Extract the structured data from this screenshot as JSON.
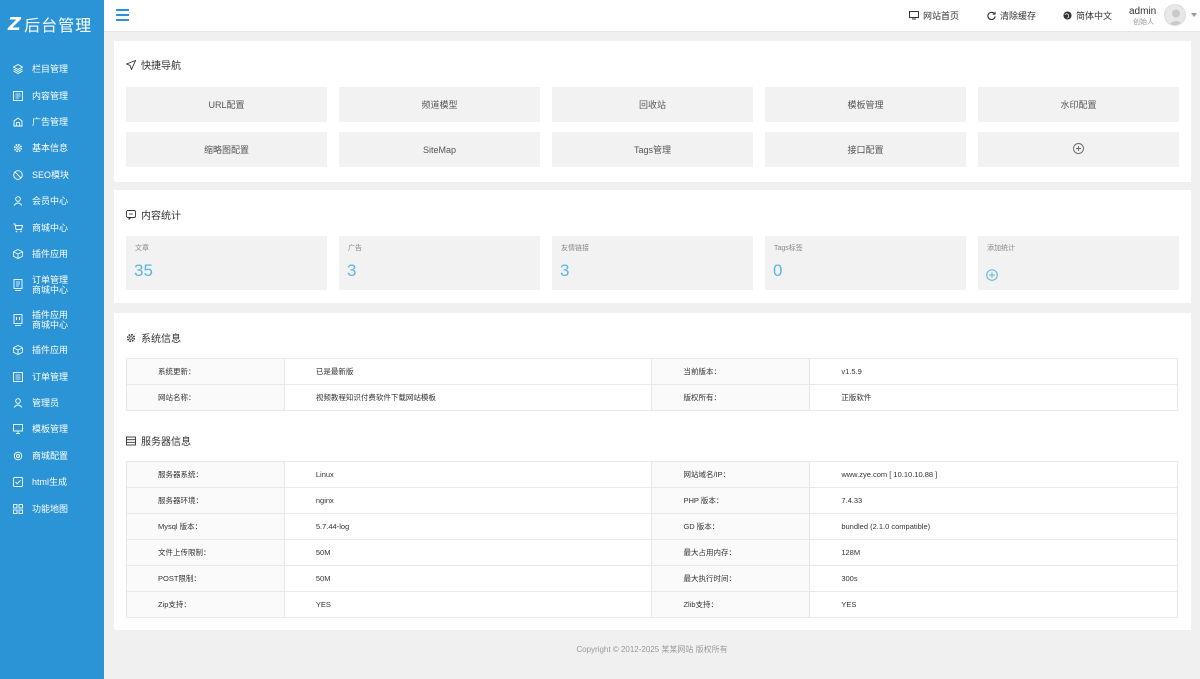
{
  "brand": {
    "logo_mark": "Z",
    "title": "后台管理"
  },
  "sidebar": {
    "items": [
      {
        "label": "栏目管理",
        "icon": "layers-icon"
      },
      {
        "label": "内容管理",
        "icon": "document-icon"
      },
      {
        "label": "广告管理",
        "icon": "ad-icon"
      },
      {
        "label": "基本信息",
        "icon": "gear-icon"
      },
      {
        "label": "SEO模块",
        "icon": "seo-icon"
      },
      {
        "label": "会员中心",
        "icon": "user-icon"
      },
      {
        "label": "商城中心",
        "icon": "cart-icon"
      },
      {
        "label": "插件应用",
        "icon": "cube-icon"
      },
      {
        "label": "订单管理",
        "label2": "商城中心",
        "icon": "order-icon"
      },
      {
        "label": "插件应用",
        "label2": "商城中心",
        "icon": "plugin-icon"
      },
      {
        "label": "插件应用",
        "icon": "cube-icon"
      },
      {
        "label": "订单管理",
        "icon": "list-icon"
      },
      {
        "label": "管理员",
        "icon": "admin-icon"
      },
      {
        "label": "模板管理",
        "icon": "monitor-icon"
      },
      {
        "label": "商城配置",
        "icon": "settings-icon"
      },
      {
        "label": "html生成",
        "icon": "check-square-icon"
      },
      {
        "label": "功能地图",
        "icon": "grid-icon"
      }
    ]
  },
  "header": {
    "menu_icon": "hamburger-icon",
    "site_home": "网站首页",
    "clear_cache": "清除缓存",
    "language": "简体中文",
    "admin_name": "admin",
    "admin_role": "创始人"
  },
  "quick_nav": {
    "title": "快捷导航",
    "buttons": [
      "URL配置",
      "频道模型",
      "回收站",
      "模板管理",
      "水印配置",
      "缩略图配置",
      "SiteMap",
      "Tags管理",
      "接口配置"
    ],
    "add_icon": "plus-circle-icon"
  },
  "content_stats": {
    "title": "内容统计",
    "items": [
      {
        "label": "文章",
        "value": "35"
      },
      {
        "label": "广告",
        "value": "3"
      },
      {
        "label": "友情链接",
        "value": "3"
      },
      {
        "label": "Tags标签",
        "value": "0"
      },
      {
        "label": "添加统计",
        "value": ""
      }
    ]
  },
  "system_info": {
    "title": "系统信息",
    "rows": [
      [
        "系统更新：",
        "已是最新版",
        "当前版本：",
        "v1.5.9"
      ],
      [
        "网站名称：",
        "视频教程知识付费软件下载网站模板",
        "版权所有：",
        "正版软件"
      ]
    ]
  },
  "server_info": {
    "title": "服务器信息",
    "rows": [
      [
        "服务器系统：",
        "Linux",
        "网站域名/IP：",
        "www.zye.com [ 10.10.10.88 ]"
      ],
      [
        "服务器环境：",
        "nginx",
        "PHP 版本：",
        "7.4.33"
      ],
      [
        "Mysql 版本：",
        "5.7.44-log",
        "GD 版本：",
        "bundled (2.1.0 compatible)"
      ],
      [
        "文件上传限制：",
        "50M",
        "最大占用内存：",
        "128M"
      ],
      [
        "POST限制：",
        "50M",
        "最大执行时间：",
        "300s"
      ],
      [
        "Zip支持：",
        "YES",
        "Zlib支持：",
        "YES"
      ]
    ]
  },
  "footer": {
    "copyright": "Copyright © 2012-2025 某某网站 版权所有"
  },
  "colors": {
    "accent": "#2b94d6",
    "stat_value": "#5bb7e6",
    "page_bg": "#f0f0f0"
  }
}
